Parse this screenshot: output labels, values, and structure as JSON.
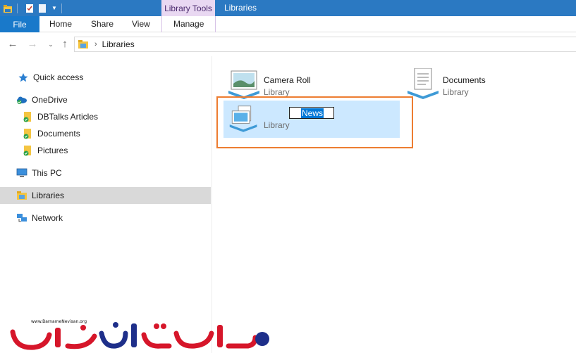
{
  "titlebar": {
    "title": "Libraries",
    "contextual_tab": "Library Tools",
    "colors": {
      "bar": "#2b79c2",
      "contextual": "#e9d8f2"
    }
  },
  "ribbon": {
    "file_label": "File",
    "tabs": [
      {
        "label": "Home"
      },
      {
        "label": "Share"
      },
      {
        "label": "View"
      },
      {
        "label": "Manage"
      }
    ]
  },
  "address": {
    "breadcrumb": "Libraries",
    "icon": "library-folder-icon"
  },
  "navpane": {
    "items": [
      {
        "label": "Quick access",
        "icon": "star-icon"
      },
      {
        "label": "OneDrive",
        "icon": "onedrive-icon"
      },
      {
        "label": "DBTalks Articles",
        "icon": "synced-folder-icon"
      },
      {
        "label": "Documents",
        "icon": "synced-folder-icon"
      },
      {
        "label": "Pictures",
        "icon": "synced-folder-icon"
      },
      {
        "label": "This PC",
        "icon": "computer-icon"
      },
      {
        "label": "Libraries",
        "icon": "library-folder-icon",
        "selected": true
      },
      {
        "label": "Network",
        "icon": "network-icon"
      }
    ]
  },
  "content": {
    "libraries": [
      {
        "name": "Camera Roll",
        "type": "Library",
        "icon": "camera-roll-library-icon"
      },
      {
        "name": "Documents",
        "type": "Library",
        "icon": "documents-library-icon"
      }
    ],
    "new_library": {
      "rename_value": "News",
      "type": "Library",
      "icon": "generic-library-icon"
    },
    "highlight_color": "#ed7d31",
    "selection_color": "#cce8ff"
  },
  "watermark": {
    "url": "www.BarnameNevisan.org",
    "logo_text": "برنامه نویسان"
  }
}
